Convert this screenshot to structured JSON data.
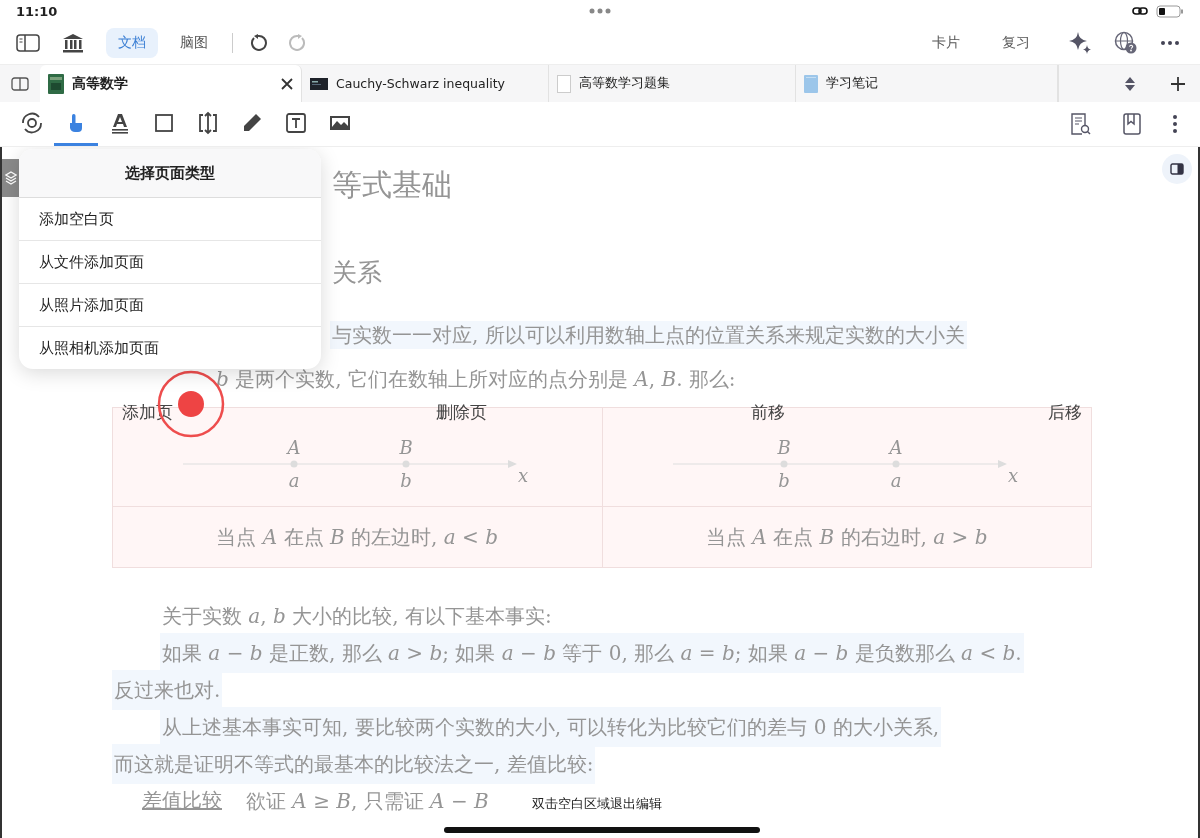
{
  "status_bar": {
    "time": "11:10"
  },
  "toolbar": {
    "views": [
      {
        "label": "文档",
        "selected": true
      },
      {
        "label": "脑图",
        "selected": false
      }
    ],
    "redo_disabled": true,
    "actions": [
      "卡片",
      "复习"
    ]
  },
  "tabs": [
    {
      "title": "高等数学",
      "selected": true
    },
    {
      "title": "Cauchy-Schwarz inequality",
      "selected": false
    },
    {
      "title": "高等数学习题集",
      "selected": false
    },
    {
      "title": "学习笔记",
      "selected": false
    }
  ],
  "tools": [
    {
      "kind": "rotate",
      "selected": false
    },
    {
      "kind": "hand",
      "selected": true
    },
    {
      "kind": "text",
      "selected": false
    },
    {
      "kind": "rect",
      "selected": false
    },
    {
      "kind": "resize",
      "selected": false
    },
    {
      "kind": "pen",
      "selected": false
    },
    {
      "kind": "textbox",
      "selected": false
    },
    {
      "kind": "image",
      "selected": false
    }
  ],
  "page_menu": {
    "title": "选择页面类型",
    "items": [
      "添加空白页",
      "从文件添加页面",
      "从照片添加页面",
      "从照相机添加页面"
    ]
  },
  "page_actions": [
    "添加页",
    "删除页",
    "前移",
    "后移"
  ],
  "document": {
    "heading": "等式基础",
    "subheading": "关系",
    "intro": [
      {
        "text": "与实数一一对应, 所以可以利用数轴上点的位置关系来规定实数的大小关",
        "highlight": true
      },
      {
        "text": "*b* 是两个实数, 它们在数轴上所对应的点分别是 *A*, *B*. 那么:",
        "highlight": false
      }
    ],
    "figures": [
      {
        "points": [
          {
            "upper": "A",
            "lower": "a"
          },
          {
            "upper": "B",
            "lower": "b"
          }
        ],
        "axis": "x",
        "caption": "当点 *A* 在点 *B* 的左边时, *a* < *b*"
      },
      {
        "points": [
          {
            "upper": "B",
            "lower": "b"
          },
          {
            "upper": "A",
            "lower": "a"
          }
        ],
        "axis": "x",
        "caption": "当点 *A* 在点 *B* 的右边时, *a* > *b*"
      }
    ],
    "paragraphs": [
      {
        "lines": [
          {
            "text": "关于实数 *a*, *b* 大小的比较, 有以下基本事实:",
            "highlight": false
          }
        ]
      },
      {
        "lines": [
          {
            "text": "如果 *a* − *b* 是正数, 那么 *a* > *b*; 如果 *a* − *b* 等于 0, 那么 *a* = *b*; 如果 *a* − *b* 是负数那么 *a* < *b*.",
            "highlight": true
          },
          {
            "text": "反过来也对.",
            "highlight": true
          }
        ]
      },
      {
        "lines": [
          {
            "text": "从上述基本事实可知, 要比较两个实数的大小, 可以转化为比较它们的差与 0 的大小关系,",
            "highlight": true
          },
          {
            "text": "而这就是证明不等式的最基本的比较法之一, 差值比较:",
            "highlight": true
          }
        ]
      }
    ],
    "term": "差值比较",
    "term_text": "欲证 *A* ≥ *B*, 只需证 *A* − *B*"
  },
  "toast": "双击空白区域退出编辑"
}
